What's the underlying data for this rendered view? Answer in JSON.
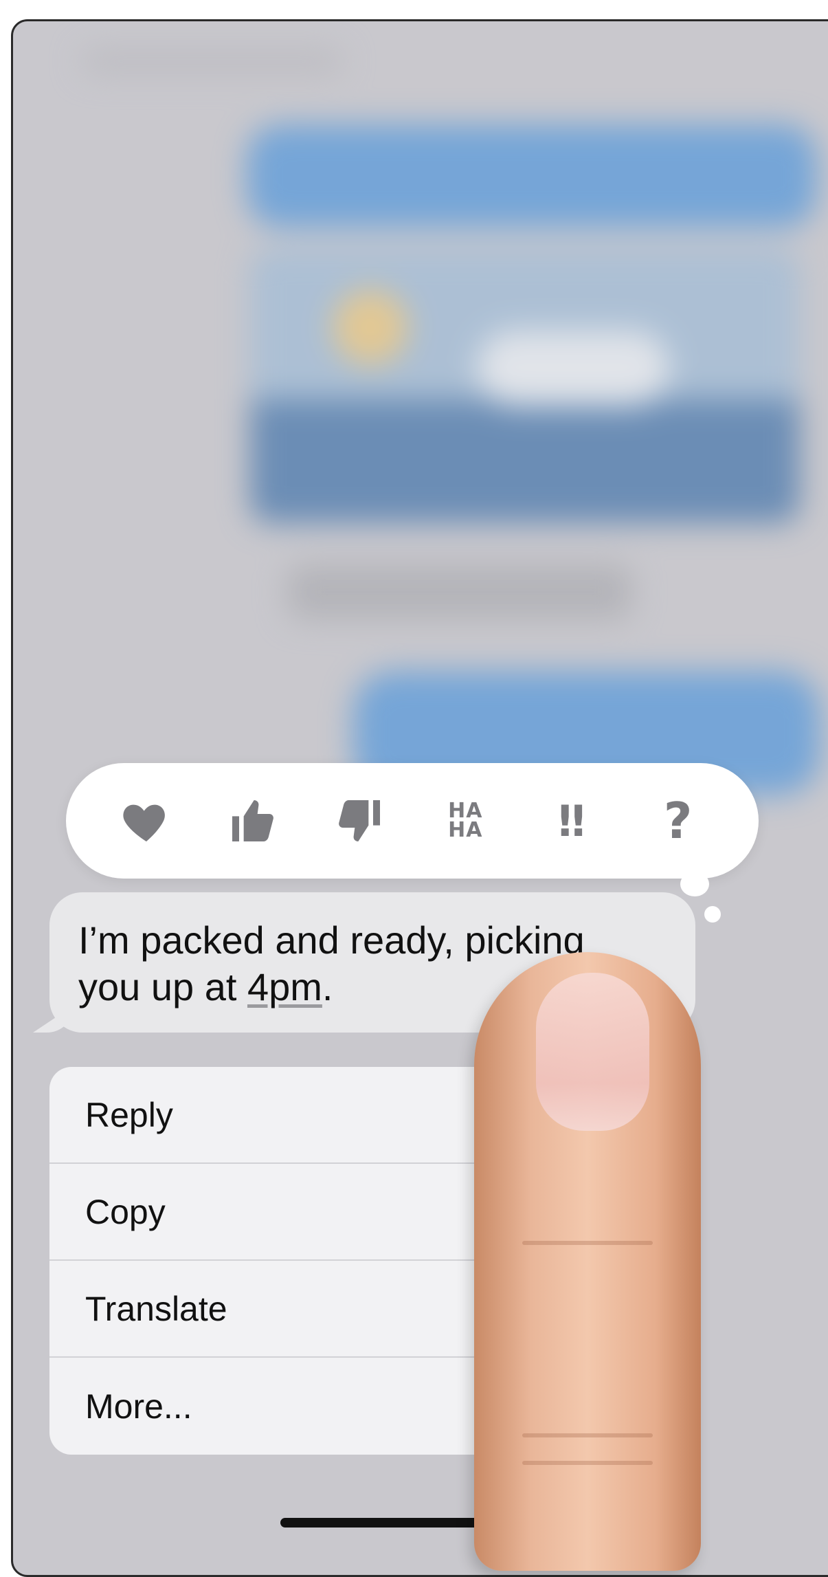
{
  "reactions": [
    {
      "name": "heart",
      "icon": "heart-icon"
    },
    {
      "name": "thumbs-up",
      "icon": "thumbs-up-icon"
    },
    {
      "name": "thumbs-down",
      "icon": "thumbs-down-icon"
    },
    {
      "name": "haha",
      "icon": "haha-icon",
      "label_line1": "HA",
      "label_line2": "HA"
    },
    {
      "name": "emphasize",
      "icon": "exclamation-icon",
      "label": "‼"
    },
    {
      "name": "question",
      "icon": "question-icon",
      "label": "?"
    }
  ],
  "message": {
    "line1": "I’m packed and ready, picking",
    "line2_prefix": "you up at ",
    "line2_link": "4pm",
    "line2_suffix": "."
  },
  "menu": {
    "items": [
      "Reply",
      "Copy",
      "Translate",
      "More..."
    ]
  },
  "colors": {
    "reaction_icon": "#7b7b7f",
    "bubble_incoming": "#e8e8ea",
    "bubble_outgoing": "#4a93dc",
    "menu_bg": "#f2f2f4"
  }
}
